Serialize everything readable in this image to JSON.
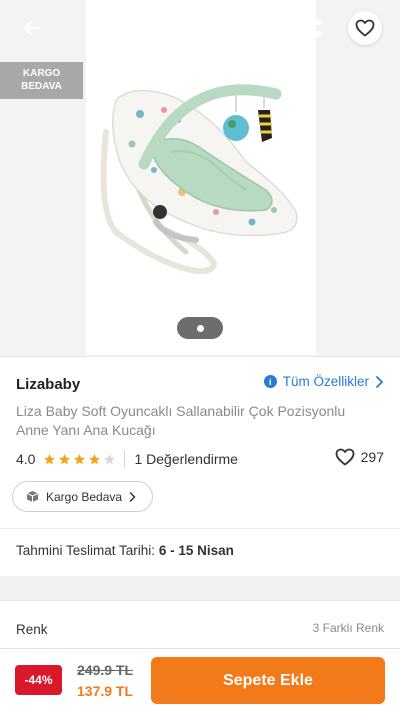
{
  "header": {
    "back_icon": "arrow-left-icon",
    "share_icon": "share-icon",
    "favorite_icon": "heart-outline-icon"
  },
  "badge": {
    "line1": "KARGO",
    "line2": "BEDAVA"
  },
  "gallery": {
    "current_page": 1,
    "total_pages": 1
  },
  "product": {
    "brand": "Lizababy",
    "all_features_label": "Tüm Özellikler",
    "title": "Liza Baby Soft Oyuncaklı Sallanabilir Çok Pozisyonlu Anne Yanı Ana Kucağı",
    "rating": "4.0",
    "rating_value": 4,
    "rating_max": 5,
    "review_count": "1 Değerlendirme",
    "favorite_count": "297",
    "shipping_chip": "Kargo Bedava",
    "delivery_label": "Tahmini Teslimat Tarihi:",
    "delivery_value": "6 - 15 Nisan"
  },
  "variant": {
    "label": "Renk",
    "count": "3 Farklı Renk"
  },
  "purchase": {
    "discount": "-44%",
    "old_price": "249.9 TL",
    "new_price": "137.9 TL",
    "add_to_cart": "Sepete Ekle"
  },
  "colors": {
    "accent": "#f27a1a",
    "link": "#2a7ad5",
    "discount": "#d9182b",
    "star": "#f2a51a"
  }
}
